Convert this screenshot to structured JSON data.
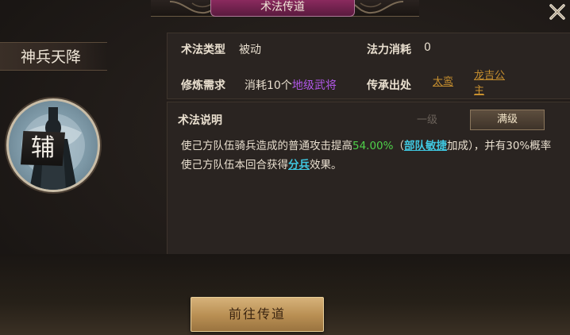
{
  "header": {
    "title": "术法传道"
  },
  "skill": {
    "name": "神兵天降",
    "role_badge": "辅"
  },
  "info": {
    "type_label": "术法类型",
    "type_value": "被动",
    "cost_label": "法力消耗",
    "cost_value": "0",
    "req_label": "修炼需求",
    "req_prefix": "消耗10个",
    "req_highlight": "地级武将",
    "source_label": "传承出处",
    "sources": [
      "太鸾",
      "龙吉公主"
    ]
  },
  "description": {
    "label": "术法说明",
    "level_tabs": [
      "一级",
      "满级"
    ],
    "selected_level": "满级",
    "seg1": "使己方队伍骑兵造成的普通攻击提高",
    "pct": "54.00%",
    "seg2": "（",
    "attr": "部队敏捷",
    "seg3": "加成），并有30%概率使己方队伍本回合获得",
    "effect": "分兵",
    "seg4": "效果。"
  },
  "actions": {
    "go_label": "前往传道"
  },
  "colors": {
    "title_tab": "#8a2a5e",
    "purple_text": "#b157e8",
    "link_orange": "#c8902f",
    "green_value": "#4fd04a",
    "cyan_keyword": "#3fc7e0",
    "button_gold": "#c9a064"
  },
  "icons": {
    "close": "close-x-icon"
  }
}
